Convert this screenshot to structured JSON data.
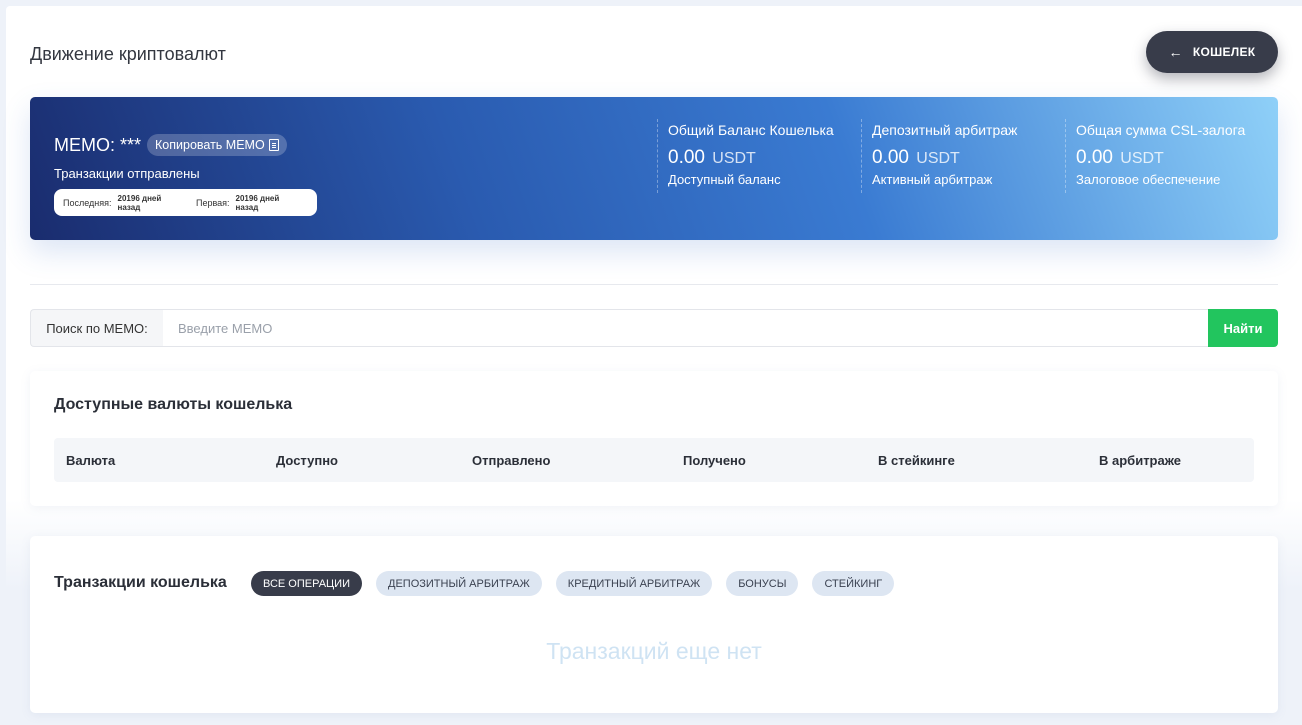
{
  "header": {
    "title": "Движение криптовалют",
    "back_label": "КОШЕЛЕК",
    "back_arrow": "←"
  },
  "banner": {
    "memo_label": "MEMO: ***",
    "copy_label": "Копировать MEMO",
    "status": "Транзакции отправлены",
    "last_label": "Последняя:",
    "last_value": "20196 дней назад",
    "first_label": "Первая:",
    "first_value": "20196 дней назад",
    "stats": [
      {
        "label": "Общий Баланс Кошелька",
        "value": "0.00",
        "unit": "USDT",
        "sub": "Доступный баланс"
      },
      {
        "label": "Депозитный арбитраж",
        "value": "0.00",
        "unit": "USDT",
        "sub": "Активный арбитраж"
      },
      {
        "label": "Общая сумма CSL-залога",
        "value": "0.00",
        "unit": "USDT",
        "sub": "Залоговое обеспечение"
      }
    ]
  },
  "search": {
    "label": "Поиск по MEMO:",
    "placeholder": "Введите MEMO",
    "value": "",
    "button_label": "Найти"
  },
  "currencies": {
    "title": "Доступные валюты кошелька",
    "columns": [
      "Валюта",
      "Доступно",
      "Отправлено",
      "Получено",
      "В стейкинге",
      "В арбитраже"
    ]
  },
  "transactions": {
    "title": "Транзакции кошелька",
    "filters": [
      "ВСЕ ОПЕРАЦИИ",
      "ДЕПОЗИТНЫЙ АРБИТРАЖ",
      "КРЕДИТНЫЙ АРБИТРАЖ",
      "БОНУСЫ",
      "СТЕЙКИНГ"
    ],
    "active_filter": 0,
    "empty_message": "Транзакций еще нет"
  },
  "colors": {
    "accent_dark": "#383c4a",
    "search_button": "#22c55e",
    "banner_start": "#1a2c6e",
    "banner_end": "#8fd0f8"
  },
  "icons": {
    "back": "arrow-left-icon",
    "copy": "copy-icon"
  }
}
